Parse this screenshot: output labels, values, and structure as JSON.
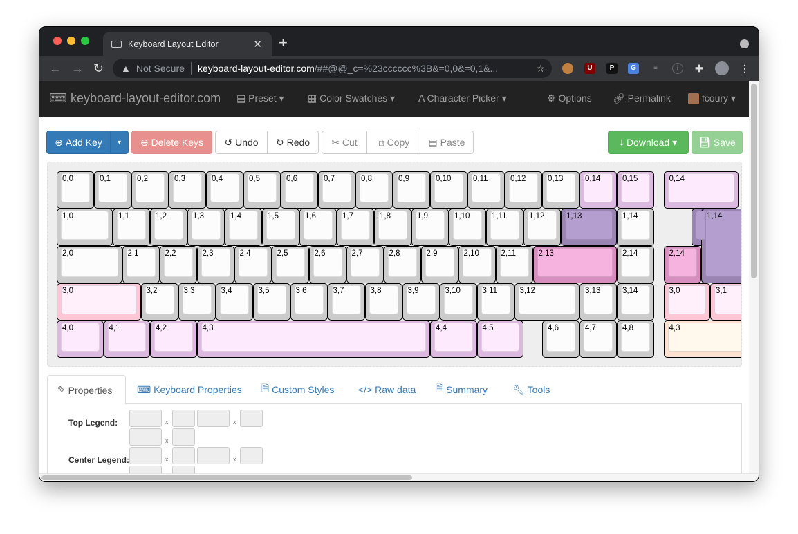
{
  "browser": {
    "tab_title": "Keyboard Layout Editor",
    "security": "Not Secure",
    "url_host": "keyboard-layout-editor.com",
    "url_rest": "/##@@_c=%23cccccc%3B&=0,0&=0,1&...",
    "extensions": [
      "owl-icon",
      "ublock-icon",
      "p-icon",
      "translate-icon",
      "list-icon",
      "info-icon",
      "puzzle-icon"
    ]
  },
  "navbar": {
    "brand": "keyboard-layout-editor.com",
    "preset": "Preset",
    "swatches": "Color Swatches",
    "picker": "Character Picker",
    "options": "Options",
    "permalink": "Permalink",
    "user": "fcoury"
  },
  "toolbar": {
    "add_key": "Add Key",
    "delete_keys": "Delete Keys",
    "undo": "Undo",
    "redo": "Redo",
    "cut": "Cut",
    "copy": "Copy",
    "paste": "Paste",
    "download": "Download",
    "save": "Save"
  },
  "colors": {
    "white": [
      "#cccccc",
      "#fcfcfc"
    ],
    "lavender": [
      "#dcb9de",
      "#fdebfd"
    ],
    "purple": [
      "#9a84b1",
      "#b39ecf"
    ],
    "pink": [
      "#d68ebe",
      "#f6b3df"
    ],
    "rose": [
      "#ffc7d6",
      "#fff0fb"
    ],
    "peach": [
      "#ffe1d1",
      "#fff8ec"
    ],
    "primary": "#337ab7",
    "danger": "#e7908e",
    "success": "#5cb85c",
    "success_light": "#95d095"
  },
  "keys": [
    {
      "tl": "0,0",
      "x": 0,
      "y": 0
    },
    {
      "tl": "0,1",
      "x": 1,
      "y": 0
    },
    {
      "tl": "0,2",
      "x": 2,
      "y": 0
    },
    {
      "tl": "0,3",
      "x": 3,
      "y": 0
    },
    {
      "tl": "0,4",
      "x": 4,
      "y": 0
    },
    {
      "tl": "0,5",
      "x": 5,
      "y": 0
    },
    {
      "tl": "0,6",
      "x": 6,
      "y": 0
    },
    {
      "tl": "0,7",
      "x": 7,
      "y": 0
    },
    {
      "tl": "0,8",
      "x": 8,
      "y": 0
    },
    {
      "tl": "0,9",
      "x": 9,
      "y": 0
    },
    {
      "tl": "0,10",
      "x": 10,
      "y": 0
    },
    {
      "tl": "0,11",
      "x": 11,
      "y": 0
    },
    {
      "tl": "0,12",
      "x": 12,
      "y": 0
    },
    {
      "tl": "0,13",
      "x": 13,
      "y": 0
    },
    {
      "tl": "0,14",
      "br": "0,0",
      "x": 14,
      "y": 0,
      "c": "lavender"
    },
    {
      "tl": "0,15",
      "br": "0,0",
      "x": 15,
      "y": 0,
      "c": "lavender"
    },
    {
      "tl": "0,14",
      "br": "0,1",
      "x": 16.25,
      "y": 0,
      "w": 2,
      "c": "lavender"
    },
    {
      "tl": "1,0",
      "x": 0,
      "y": 1,
      "w": 1.5
    },
    {
      "tl": "1,1",
      "x": 1.5,
      "y": 1
    },
    {
      "tl": "1,2",
      "x": 2.5,
      "y": 1
    },
    {
      "tl": "1,3",
      "x": 3.5,
      "y": 1
    },
    {
      "tl": "1,4",
      "x": 4.5,
      "y": 1
    },
    {
      "tl": "1,5",
      "x": 5.5,
      "y": 1
    },
    {
      "tl": "1,6",
      "x": 6.5,
      "y": 1
    },
    {
      "tl": "1,7",
      "x": 7.5,
      "y": 1
    },
    {
      "tl": "1,8",
      "x": 8.5,
      "y": 1
    },
    {
      "tl": "1,9",
      "x": 9.5,
      "y": 1
    },
    {
      "tl": "1,10",
      "x": 10.5,
      "y": 1
    },
    {
      "tl": "1,11",
      "x": 11.5,
      "y": 1
    },
    {
      "tl": "1,12",
      "x": 12.5,
      "y": 1
    },
    {
      "tl": "1,13",
      "br": "1,0",
      "x": 13.5,
      "y": 1,
      "w": 1.5,
      "c": "purple"
    },
    {
      "tl": "1,14",
      "x": 15,
      "y": 1
    },
    {
      "tl": "1,14",
      "br": "1,1",
      "x": 17,
      "y": 1,
      "w": 1.5,
      "h": 1,
      "x2": 0.25,
      "w2": 1.25,
      "h2": 2,
      "c": "purple"
    },
    {
      "tl": "2,0",
      "x": 0,
      "y": 2,
      "w": 1.75
    },
    {
      "tl": "2,1",
      "x": 1.75,
      "y": 2
    },
    {
      "tl": "2,2",
      "x": 2.75,
      "y": 2
    },
    {
      "tl": "2,3",
      "x": 3.75,
      "y": 2
    },
    {
      "tl": "2,4",
      "x": 4.75,
      "y": 2
    },
    {
      "tl": "2,5",
      "x": 5.75,
      "y": 2
    },
    {
      "tl": "2,6",
      "x": 6.75,
      "y": 2
    },
    {
      "tl": "2,7",
      "x": 7.75,
      "y": 2
    },
    {
      "tl": "2,8",
      "x": 8.75,
      "y": 2
    },
    {
      "tl": "2,9",
      "x": 9.75,
      "y": 2
    },
    {
      "tl": "2,10",
      "x": 10.75,
      "y": 2
    },
    {
      "tl": "2,11",
      "x": 11.75,
      "y": 2
    },
    {
      "tl": "2,13",
      "br": "2,0",
      "x": 12.75,
      "y": 2,
      "w": 2.25,
      "c": "pink"
    },
    {
      "tl": "2,14",
      "x": 15,
      "y": 2
    },
    {
      "tl": "2,14",
      "br": "2,1",
      "x": 16.25,
      "y": 2,
      "c": "pink"
    },
    {
      "tl": "3,0",
      "br": "3,0",
      "x": 0,
      "y": 3,
      "w": 2.25,
      "c": "rose"
    },
    {
      "tl": "3,2",
      "x": 2.25,
      "y": 3
    },
    {
      "tl": "3,3",
      "x": 3.25,
      "y": 3
    },
    {
      "tl": "3,4",
      "x": 4.25,
      "y": 3
    },
    {
      "tl": "3,5",
      "x": 5.25,
      "y": 3
    },
    {
      "tl": "3,6",
      "x": 6.25,
      "y": 3
    },
    {
      "tl": "3,7",
      "x": 7.25,
      "y": 3
    },
    {
      "tl": "3,8",
      "x": 8.25,
      "y": 3
    },
    {
      "tl": "3,9",
      "x": 9.25,
      "y": 3
    },
    {
      "tl": "3,10",
      "x": 10.25,
      "y": 3
    },
    {
      "tl": "3,11",
      "x": 11.25,
      "y": 3
    },
    {
      "tl": "3,12",
      "x": 12.25,
      "y": 3,
      "w": 1.75
    },
    {
      "tl": "3,13",
      "x": 14,
      "y": 3
    },
    {
      "tl": "3,14",
      "x": 15,
      "y": 3
    },
    {
      "tl": "3,0",
      "br": "3,1",
      "x": 16.25,
      "y": 3,
      "w": 1.25,
      "c": "rose"
    },
    {
      "tl": "3,1",
      "br": "3,1",
      "x": 17.5,
      "y": 3,
      "c": "rose"
    },
    {
      "tl": "4,0",
      "br": "5,0",
      "x": 0,
      "y": 4,
      "w": 1.25,
      "c": "lavender"
    },
    {
      "tl": "4,1",
      "br": "5,0",
      "x": 1.25,
      "y": 4,
      "w": 1.25,
      "c": "lavender"
    },
    {
      "tl": "4,2",
      "br": "5,0",
      "x": 2.5,
      "y": 4,
      "w": 1.25,
      "c": "lavender"
    },
    {
      "tl": "4,3",
      "br": "5,0",
      "x": 3.75,
      "y": 4,
      "w": 6.25,
      "c": "lavender"
    },
    {
      "tl": "4,4",
      "br": "5,0",
      "x": 10,
      "y": 4,
      "w": 1.25,
      "c": "lavender"
    },
    {
      "tl": "4,5",
      "br": "5,0",
      "x": 11.25,
      "y": 4,
      "w": 1.25,
      "c": "lavender"
    },
    {
      "tl": "4,6",
      "x": 13,
      "y": 4
    },
    {
      "tl": "4,7",
      "x": 14,
      "y": 4
    },
    {
      "tl": "4,8",
      "x": 15,
      "y": 4
    },
    {
      "tl": "4,3",
      "br": "4,1",
      "x": 16.25,
      "y": 4,
      "w": 2.25,
      "c": "peach"
    }
  ],
  "tabs": [
    "Properties",
    "Keyboard Properties",
    "Custom Styles",
    "Raw data",
    "Summary",
    "Tools"
  ],
  "properties": {
    "top_legend": "Top Legend:",
    "center_legend": "Center Legend:",
    "x": "x"
  }
}
